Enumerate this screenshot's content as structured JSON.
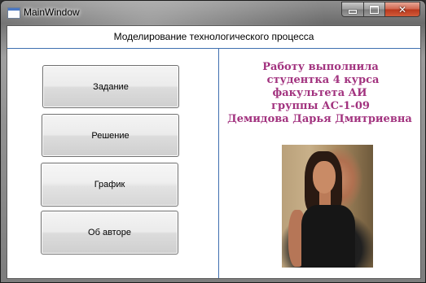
{
  "window": {
    "title": "MainWindow"
  },
  "header": {
    "title": "Моделирование технологического процесса"
  },
  "buttons": [
    {
      "label": "Задание"
    },
    {
      "label": "Решение"
    },
    {
      "label": "График"
    },
    {
      "label": "Об авторе"
    }
  ],
  "author": {
    "lines": [
      "Работу выполнила",
      "студентка 4 курса",
      "факультета АИ",
      "группы АС-1-09",
      "Демидова Дарья Дмитриевна"
    ],
    "color": "#a2337f"
  },
  "icons": {
    "minimize": "minimize-icon",
    "maximize": "maximize-icon",
    "close": "close-icon"
  }
}
